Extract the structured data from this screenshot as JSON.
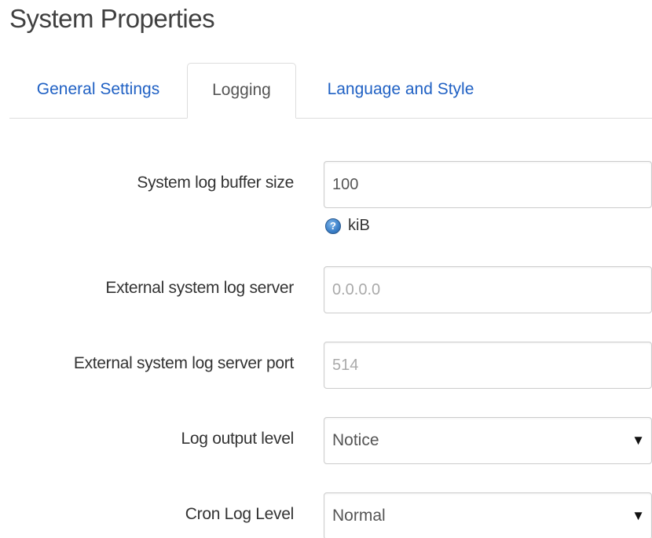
{
  "page": {
    "title": "System Properties"
  },
  "tabs": [
    {
      "label": "General Settings"
    },
    {
      "label": "Logging"
    },
    {
      "label": "Language and Style"
    }
  ],
  "active_tab": "Logging",
  "form": {
    "log_buffer_size": {
      "label": "System log buffer size",
      "value": "100",
      "unit": "kiB",
      "help_icon": "help-question-icon"
    },
    "log_server": {
      "label": "External system log server",
      "placeholder": "0.0.0.0"
    },
    "log_server_port": {
      "label": "External system log server port",
      "placeholder": "514"
    },
    "log_output_level": {
      "label": "Log output level",
      "selected": "Notice"
    },
    "cron_log_level": {
      "label": "Cron Log Level",
      "selected": "Normal"
    }
  },
  "colors": {
    "link": "#2061c4",
    "border": "#cccccc",
    "text": "#333333"
  }
}
